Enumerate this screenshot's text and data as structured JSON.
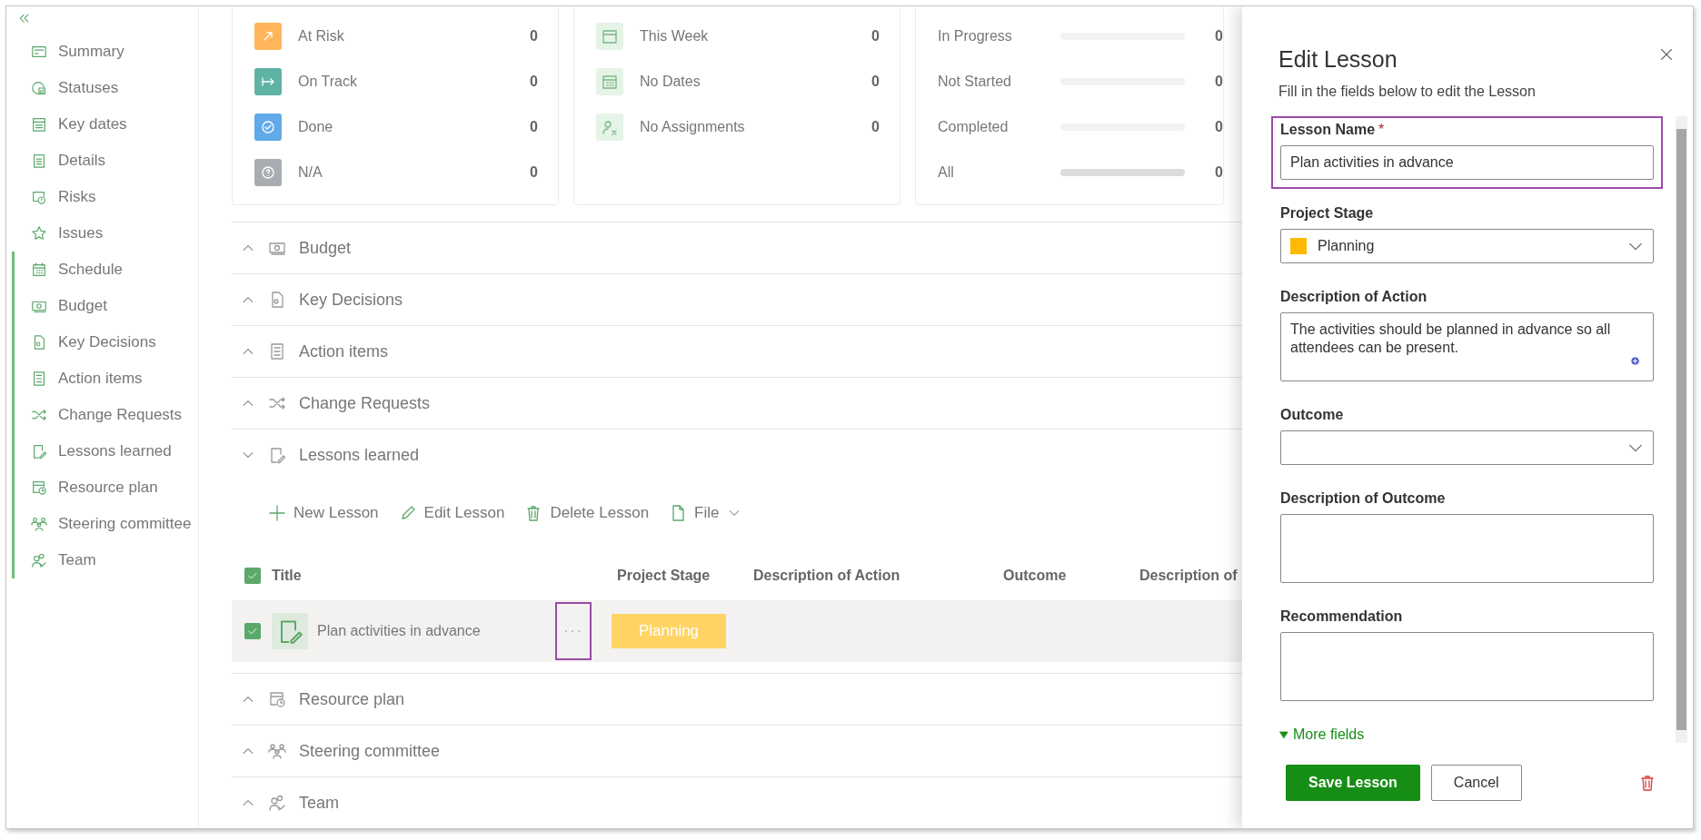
{
  "sidebar": {
    "items": [
      {
        "label": "Summary",
        "marked": false
      },
      {
        "label": "Statuses",
        "marked": false
      },
      {
        "label": "Key dates",
        "marked": false
      },
      {
        "label": "Details",
        "marked": false
      },
      {
        "label": "Risks",
        "marked": false
      },
      {
        "label": "Issues",
        "marked": false
      },
      {
        "label": "Schedule",
        "marked": true
      },
      {
        "label": "Budget",
        "marked": true
      },
      {
        "label": "Key Decisions",
        "marked": true
      },
      {
        "label": "Action items",
        "marked": true
      },
      {
        "label": "Change Requests",
        "marked": true
      },
      {
        "label": "Lessons learned",
        "marked": true
      },
      {
        "label": "Resource plan",
        "marked": true
      },
      {
        "label": "Steering committee",
        "marked": true
      },
      {
        "label": "Team",
        "marked": true
      }
    ]
  },
  "cards": [
    {
      "kind": "status",
      "rows": [
        {
          "label": "At Risk",
          "count": "0",
          "color": "#ffb65a"
        },
        {
          "label": "On Track",
          "count": "0",
          "color": "#5fb3a4"
        },
        {
          "label": "Done",
          "count": "0",
          "color": "#62a9e8"
        },
        {
          "label": "N/A",
          "count": "0",
          "color": "#a9acb0"
        }
      ]
    },
    {
      "kind": "dates",
      "rows": [
        {
          "label": "This Week",
          "count": "0"
        },
        {
          "label": "No Dates",
          "count": "0"
        },
        {
          "label": "No Assignments",
          "count": "0"
        }
      ]
    },
    {
      "kind": "progress",
      "rows": [
        {
          "label": "In Progress",
          "level": 0,
          "count": "0",
          "kind": "status"
        },
        {
          "label": "Not Started",
          "level": 0,
          "count": "0",
          "kind": "status"
        },
        {
          "label": "Completed",
          "level": 0,
          "count": "0",
          "kind": "status"
        },
        {
          "label": "All",
          "level": 0,
          "count": "0",
          "kind": "total"
        }
      ]
    }
  ],
  "sections": [
    {
      "label": "Budget",
      "expanded": false
    },
    {
      "label": "Key Decisions",
      "expanded": false
    },
    {
      "label": "Action items",
      "expanded": false
    },
    {
      "label": "Change Requests",
      "expanded": false
    },
    {
      "label": "Lessons learned",
      "expanded": true,
      "toolbar": [
        {
          "label": "New Lesson",
          "menu": false
        },
        {
          "label": "Edit Lesson",
          "menu": false
        },
        {
          "label": "Delete Lesson",
          "menu": false
        },
        {
          "label": "File",
          "menu": true
        }
      ],
      "table": {
        "all_checked": true,
        "columns": [
          "Title",
          "Project Stage",
          "Description of Action",
          "Outcome",
          "Description of"
        ],
        "rows": [
          {
            "selected": true,
            "title": "Plan activities in advance",
            "more": "···",
            "more_highlighted": true,
            "stage": {
              "label": "Planning",
              "color": "#ffd465"
            }
          }
        ]
      }
    },
    {
      "label": "Resource plan",
      "expanded": false
    },
    {
      "label": "Steering committee",
      "expanded": false
    },
    {
      "label": "Team",
      "expanded": false
    }
  ],
  "panel": {
    "title": "Edit Lesson",
    "subtitle": "Fill in the fields below to edit the Lesson",
    "fields": [
      {
        "kind": "text",
        "label": "Lesson Name",
        "required_mark": "*",
        "value": "Plan activities in advance",
        "highlighted": true
      },
      {
        "kind": "select",
        "label": "Project Stage",
        "value": "Planning",
        "color": "#ffb900",
        "highlighted": false
      },
      {
        "kind": "textarea",
        "label": "Description of Action",
        "value": "The activities should be planned in advance so all attendees can be present.",
        "highlighted": false
      },
      {
        "kind": "select",
        "label": "Outcome",
        "highlighted": false
      },
      {
        "kind": "textarea",
        "label": "Description of Outcome",
        "highlighted": false
      },
      {
        "kind": "textarea",
        "label": "Recommendation",
        "highlighted": false
      }
    ],
    "more_fields": "More fields",
    "buttons": [
      {
        "label": "Save Lesson",
        "primary": true
      },
      {
        "label": "Cancel",
        "primary": false
      }
    ]
  }
}
